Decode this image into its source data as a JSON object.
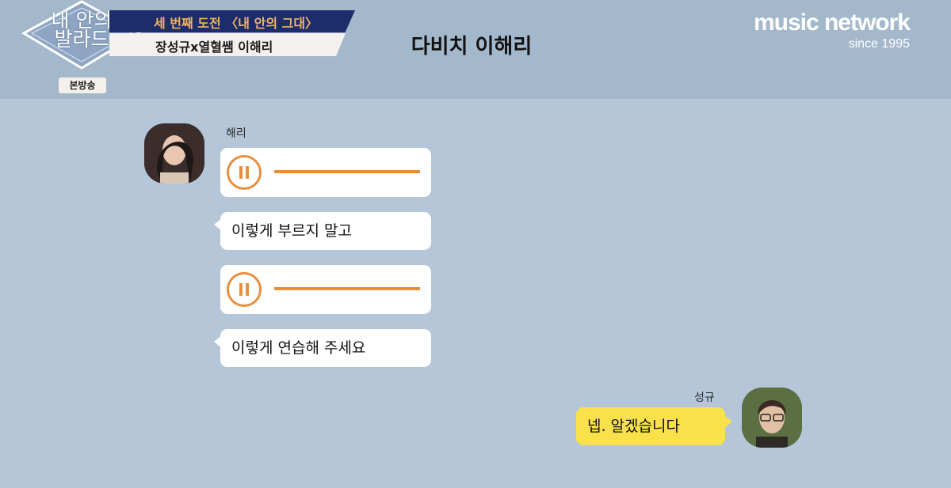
{
  "header": {
    "logo_text": "내 안의\n발라드",
    "broadcast_badge": "본방송",
    "banner_top": "세 번째 도전 〈내 안의 그대〉",
    "banner_bottom": "장성규x열혈쌤 이해리",
    "title": "다비치 이해리",
    "network_brand": "music network",
    "network_since": "since 1995"
  },
  "chat": {
    "left_sender": "해리",
    "right_sender": "성규",
    "messages": [
      {
        "type": "voice",
        "progress": 1.0
      },
      {
        "type": "text",
        "text": "이렇게 부르지 말고"
      },
      {
        "type": "voice",
        "progress": 1.0
      },
      {
        "type": "text",
        "text": "이렇게 연습해 주세요"
      },
      {
        "type": "reply",
        "text": "넵. 알겠습니다"
      }
    ]
  },
  "colors": {
    "chat_background": "#b5c6d9",
    "header_background": "#a4b8cc",
    "voice_accent": "#e88f3d",
    "reply_bubble": "#f8e14b"
  },
  "icons": [
    "pause-icon",
    "pause-icon"
  ]
}
